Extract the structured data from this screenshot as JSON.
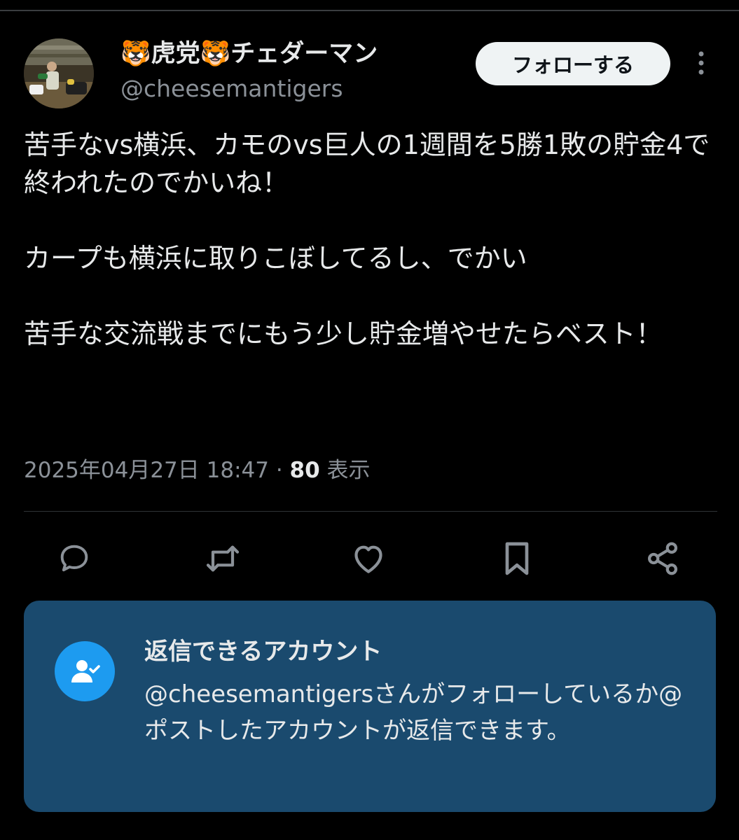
{
  "author": {
    "emoji": "🐯",
    "name": "虎党",
    "name_suffix": "チェダーマン",
    "handle": "@cheesemantigers"
  },
  "follow_label": "フォローする",
  "post": {
    "paragraph1": "苦手なvs横浜、カモのvs巨人の1週間を5勝1敗の貯金4で終われたのでかいね！",
    "paragraph2": "カープも横浜に取りこぼしてるし、でかい",
    "paragraph3": "苦手な交流戦までにもう少し貯金増やせたらベスト！"
  },
  "meta": {
    "datetime": "2025年04月27日 18:47",
    "separator": " · ",
    "views_count": "80",
    "views_label": " 表示"
  },
  "actions": [
    "reply-icon",
    "repost-icon",
    "like-icon",
    "bookmark-icon",
    "share-icon"
  ],
  "notice": {
    "title": "返信できるアカウント",
    "text": "@cheesemantigersさんがフォローしているか@ポストしたアカウントが返信できます。"
  },
  "colors": {
    "background": "#000000",
    "text": "#e7e9ea",
    "muted": "#8b9198",
    "notice_bg": "#1a4a6e",
    "accent": "#1d9bf0"
  }
}
